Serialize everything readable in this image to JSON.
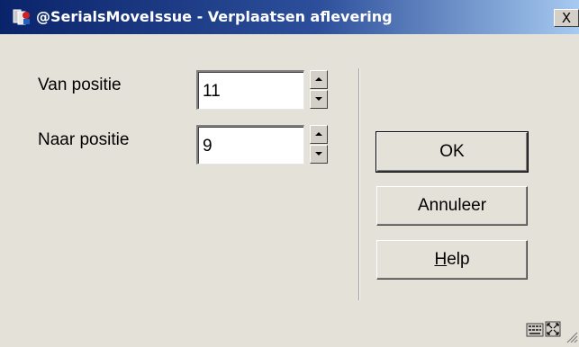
{
  "window": {
    "title": "@SerialsMoveIssue - Verplaatsen aflevering",
    "close_label": "X"
  },
  "form": {
    "from_label": "Van positie",
    "from_value": "11",
    "to_label": "Naar positie",
    "to_value": "9"
  },
  "buttons": {
    "ok": "OK",
    "cancel": "Annuleer",
    "help_prefix": "H",
    "help_rest": "elp"
  },
  "status_bar": {
    "icons": [
      "keyboard-icon",
      "fullscreen-icon",
      "resize-grip-icon"
    ]
  },
  "colors": {
    "titlebar_start": "#0a246a",
    "titlebar_end": "#a6caf0",
    "dialog_bg": "#e4e1d8"
  }
}
